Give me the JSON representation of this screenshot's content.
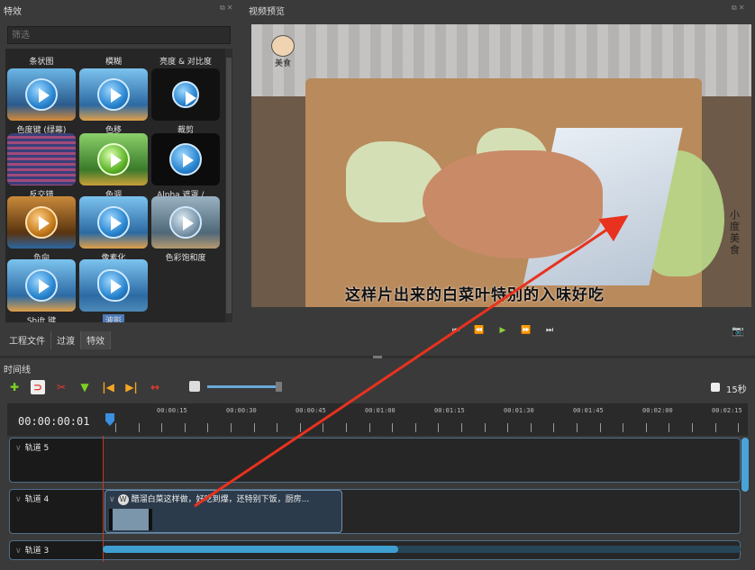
{
  "effects_panel": {
    "title": "特效",
    "filter_placeholder": "筛选",
    "items": [
      {
        "label": "条状图"
      },
      {
        "label": "模糊"
      },
      {
        "label": "亮度 & 对比度"
      },
      {
        "label": "色度键 (绿幕)"
      },
      {
        "label": "色移"
      },
      {
        "label": "裁剪"
      },
      {
        "label": "反交错"
      },
      {
        "label": "色调"
      },
      {
        "label": "Alpha 遮罩 / ..."
      },
      {
        "label": "负向"
      },
      {
        "label": "像素化"
      },
      {
        "label": "色彩饱和度"
      },
      {
        "label": "Shift 键"
      },
      {
        "label": "波形"
      }
    ],
    "tabs": [
      "工程文件",
      "过渡",
      "特效"
    ]
  },
  "preview_panel": {
    "title": "视频预览",
    "subtitle": "这样片出来的白菜叶特别的入味好吃",
    "logo_text": "美食",
    "signature": "小度美食"
  },
  "timeline": {
    "title": "时间线",
    "timecode": "00:00:00:01",
    "zoom_label": "15秒",
    "ticks": [
      "00:00:15",
      "00:00:30",
      "00:00:45",
      "00:01:00",
      "00:01:15",
      "00:01:30",
      "00:01:45",
      "00:02:00",
      "00:02:15"
    ],
    "tracks": [
      {
        "name": "轨道 5"
      },
      {
        "name": "轨道 4"
      },
      {
        "name": "轨道 3"
      }
    ],
    "clip_title": "醋溜白菜这样做，好吃到爆，还特别下饭，厨房..."
  },
  "colors": {
    "accent": "#3f9ed0",
    "playhead": "#c0392b",
    "annotation": "#e8321e"
  }
}
